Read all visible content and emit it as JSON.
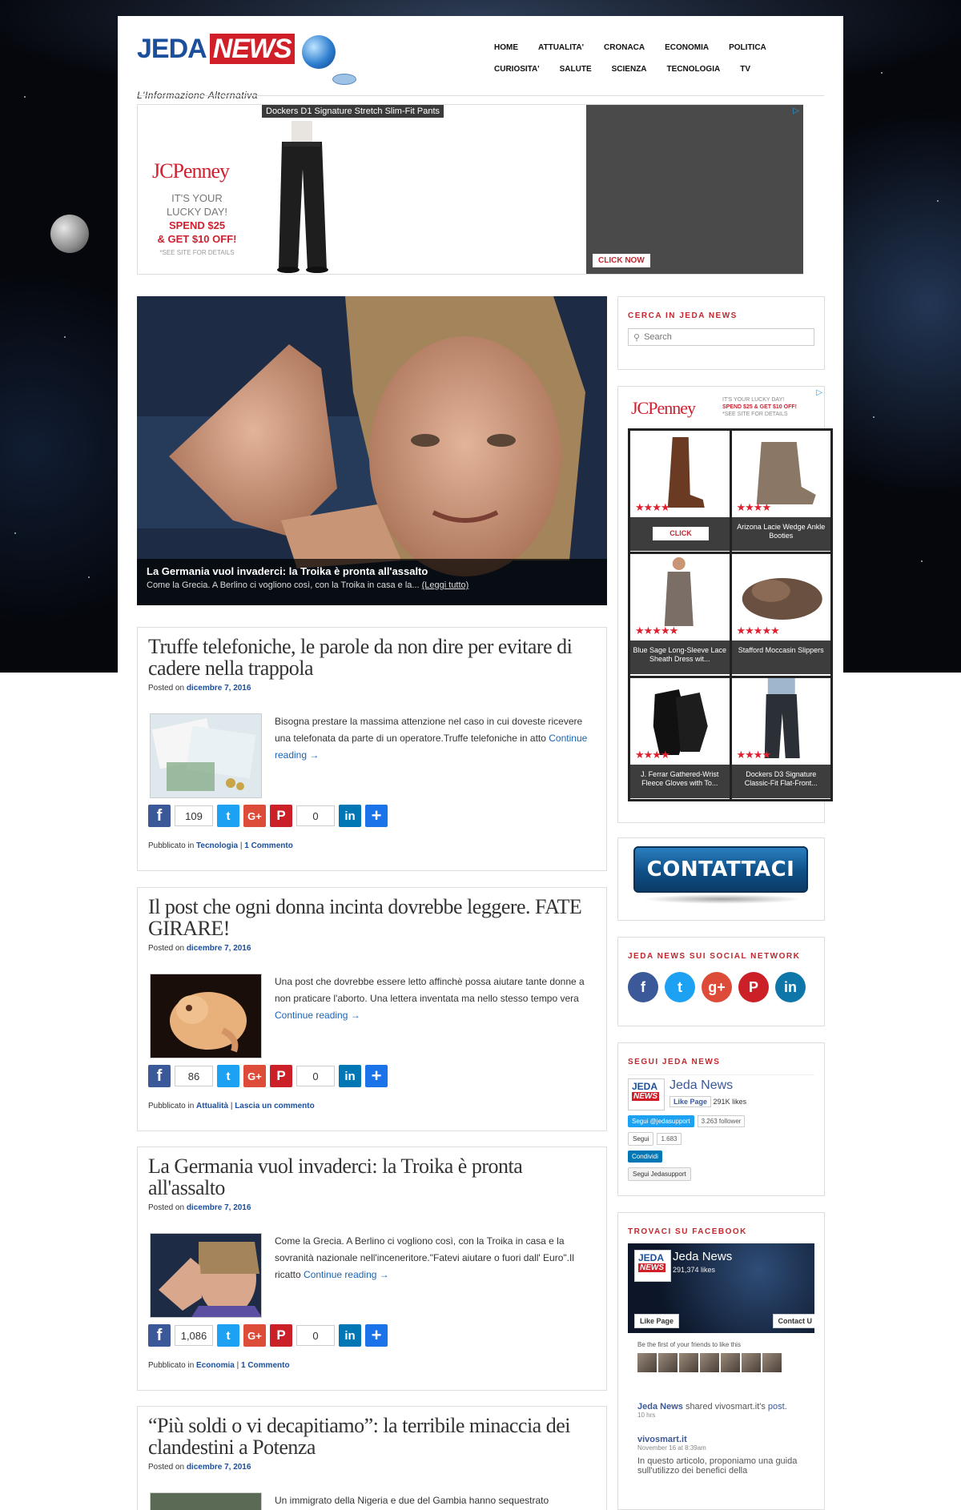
{
  "site": {
    "logo_jeda": "JEDA",
    "logo_news": "NEWS",
    "tagline": "L'Informazione Alternativa"
  },
  "nav": {
    "row1": [
      "HOME",
      "ATTUALITA'",
      "CRONACA",
      "ECONOMIA",
      "POLITICA"
    ],
    "row2": [
      "CURIOSITA'",
      "SALUTE",
      "SCIENZA",
      "TECNOLOGIA",
      "TV"
    ]
  },
  "banner_ad": {
    "caption": "Dockers D1 Signature Stretch Slim-Fit Pants",
    "brand": "JCPenney",
    "line1": "IT'S YOUR",
    "line2": "LUCKY DAY!",
    "line3": "SPEND $25",
    "line4": "& GET $10 OFF!",
    "fine": "*SEE SITE FOR DETAILS",
    "cta": "CLICK NOW"
  },
  "hero": {
    "title": "La Germania vuol invaderci: la Troika è pronta all'assalto",
    "sub": "Come la Grecia. A Berlino ci vogliono così, con la Troika in casa e la...",
    "link": "(Leggi tutto)"
  },
  "posts": [
    {
      "title": "Truffe telefoniche, le parole da non dire per evitare di cadere nella trappola",
      "posted_on": "Posted on",
      "date": "dicembre 7, 2016",
      "excerpt": "Bisogna prestare la massima attenzione nel caso in cui doveste ricevere una telefonata da parte di un operatore.Truffe telefoniche in atto",
      "continue": "Continue reading →",
      "fb_count": "109",
      "pin_count": "0",
      "published_in": "Pubblicato in",
      "category": "Tecnologia",
      "comments": "1 Commento"
    },
    {
      "title": "Il post che ogni donna incinta dovrebbe leggere. FATE GIRARE!",
      "posted_on": "Posted on",
      "date": "dicembre 7, 2016",
      "excerpt": "Una post che dovrebbe essere letto affinchè possa aiutare tante donne a non praticare l'aborto. Una lettera inventata ma nello stesso tempo vera",
      "continue": "Continue reading →",
      "fb_count": "86",
      "pin_count": "0",
      "published_in": "Pubblicato in",
      "category": "Attualità",
      "comments": "Lascia un commento"
    },
    {
      "title": "La Germania vuol invaderci: la Troika è pronta all'assalto",
      "posted_on": "Posted on",
      "date": "dicembre 7, 2016",
      "excerpt": "Come la Grecia. A Berlino ci vogliono così, con la Troika in casa e la sovranità nazionale nell'inceneritore.\"Fatevi aiutare o fuori dall' Euro\".Il ricatto",
      "continue": "Continue reading →",
      "fb_count": "1,086",
      "pin_count": "0",
      "published_in": "Pubblicato in",
      "category": "Economia",
      "comments": "1 Commento"
    },
    {
      "title": "“Più soldi o vi decapitiamo”: la terribile minaccia dei clandestini a Potenza",
      "posted_on": "Posted on",
      "date": "dicembre 7, 2016",
      "excerpt": "Un immigrato della Nigeria e due del Gambia hanno sequestrato"
    }
  ],
  "sidebar": {
    "search_title": "CERCA IN JEDA NEWS",
    "search_placeholder": "Search",
    "ad_brand": "JCPenney",
    "ad_small1": "IT'S YOUR LUCKY DAY!",
    "ad_small2": "SPEND $25 & GET $10 OFF!",
    "ad_small3": "*SEE SITE FOR DETAILS",
    "products": [
      {
        "label": "",
        "cta": "CLICK"
      },
      {
        "label": "Arizona Lacie Wedge Ankle Booties"
      },
      {
        "label": "Blue Sage Long-Sleeve Lace Sheath Dress wit..."
      },
      {
        "label": "Stafford Moccasin Slippers"
      },
      {
        "label": "J. Ferrar Gathered-Wrist Fleece Gloves with To..."
      },
      {
        "label": "Dockers D3 Signature Classic-Fit Flat-Front..."
      }
    ],
    "contact": "CONTATTACI",
    "social_title": "JEDA NEWS SUI SOCIAL NETWORK",
    "follow_title": "SEGUI JEDA NEWS",
    "follow_name": "Jeda News",
    "follow_like": "Like Page",
    "follow_likes": "291K likes",
    "follow_tw": "Segui @jedasupport",
    "follow_tw_count": "3.263 follower",
    "follow_gp": "Segui",
    "follow_gp_count": "1.683",
    "follow_li": "Condividi",
    "follow_pi": "Segui Jedasupport",
    "fb_title": "TROVACI SU FACEBOOK",
    "fb_name": "Jeda News",
    "fb_likes": "291,374 likes",
    "fb_like_btn": "Like Page",
    "fb_contact": "Contact U",
    "fb_friends": "Be the first of your friends to like this",
    "fb_post_name": "Jeda News",
    "fb_post_shared": "shared vivosmart.it's",
    "fb_post_word": "post.",
    "fb_post_time": "10 hrs",
    "fb_sub_name": "vivosmart.it",
    "fb_sub_time": "November 16 at 8:39am",
    "fb_sub_text": "In questo articolo, proponiamo una guida sull'utilizzo dei benefici della"
  },
  "colors": {
    "accent_red": "#c1272d",
    "link_blue": "#1b4f9c",
    "facebook": "#3b5998",
    "twitter": "#1da1f2",
    "googleplus": "#dd4b39",
    "pinterest": "#cb2027",
    "linkedin": "#0077b5"
  }
}
